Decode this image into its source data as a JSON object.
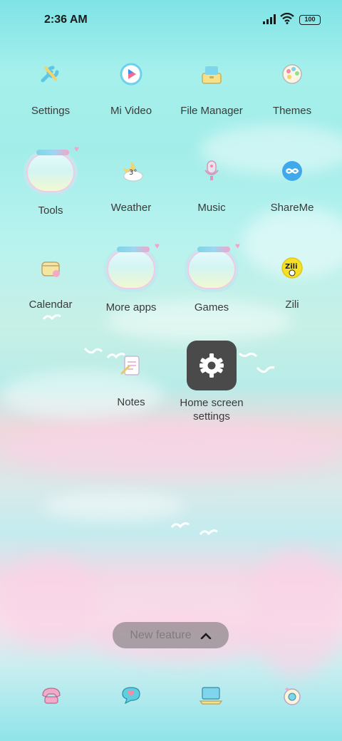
{
  "status_bar": {
    "time": "2:36 AM",
    "battery": "100",
    "icons": [
      "signal-icon",
      "wifi-icon",
      "battery-icon"
    ]
  },
  "apps": [
    {
      "label": "Settings",
      "icon": "wrench-icon"
    },
    {
      "label": "Mi Video",
      "icon": "play-icon"
    },
    {
      "label": "File Manager",
      "icon": "folder-icon"
    },
    {
      "label": "Themes",
      "icon": "palette-icon"
    },
    {
      "label": "Tools",
      "icon": "folder-icon"
    },
    {
      "label": "Weather",
      "icon": "weather-icon",
      "value": "3°"
    },
    {
      "label": "Music",
      "icon": "microphone-icon"
    },
    {
      "label": "ShareMe",
      "icon": "infinity-icon"
    },
    {
      "label": "Calendar",
      "icon": "calendar-icon"
    },
    {
      "label": "More apps",
      "icon": "folder-icon"
    },
    {
      "label": "Games",
      "icon": "folder-icon"
    },
    {
      "label": "Zili",
      "icon": "zili-icon",
      "badge": "Zili"
    },
    {
      "label": "Notes",
      "icon": "notes-icon"
    },
    {
      "label": "Home screen settings",
      "icon": "gear-icon"
    }
  ],
  "new_feature_pill": {
    "label": "New feature",
    "icon": "chevron-up-icon"
  },
  "dock": [
    {
      "icon": "phone-icon"
    },
    {
      "icon": "message-icon"
    },
    {
      "icon": "browser-icon"
    },
    {
      "icon": "camera-icon"
    }
  ],
  "colors": {
    "sky_top": "#7fe3e6",
    "label_text": "#3a3a3a",
    "settings_tile": "#4a4a4a",
    "pill_bg": "#6e6e6e"
  }
}
